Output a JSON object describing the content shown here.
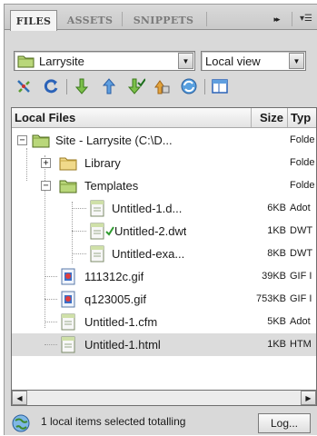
{
  "tabs": [
    {
      "label": "FILES",
      "active": true
    },
    {
      "label": "ASSETS",
      "active": false
    },
    {
      "label": "SNIPPETS",
      "active": false
    }
  ],
  "tab_overflow": "▸▸",
  "tab_menu": "▾☰",
  "site_select": {
    "value": "Larrysite"
  },
  "view_select": {
    "value": "Local view"
  },
  "toolbar": {
    "items": [
      "connect-icon",
      "refresh-icon",
      "get-files-icon",
      "put-files-icon",
      "check-out-icon",
      "check-in-icon",
      "sync-icon",
      "expand-icon"
    ]
  },
  "columns": {
    "name": "Local Files",
    "size": "Size",
    "type": "Typ"
  },
  "rows": [
    {
      "name": "Site - Larrysite (C:\\D...",
      "size": "",
      "type": "Folde"
    },
    {
      "name": "Library",
      "size": "",
      "type": "Folde"
    },
    {
      "name": "Templates",
      "size": "",
      "type": "Folde"
    },
    {
      "name": "Untitled-1.d...",
      "size": "6KB",
      "type": "Adot"
    },
    {
      "name": "Untitled-2.dwt",
      "size": "1KB",
      "type": "DWT"
    },
    {
      "name": "Untitled-exa...",
      "size": "8KB",
      "type": "DWT"
    },
    {
      "name": "111312c.gif",
      "size": "39KB",
      "type": "GIF I"
    },
    {
      "name": "q123005.gif",
      "size": "753KB",
      "type": "GIF I"
    },
    {
      "name": "Untitled-1.cfm",
      "size": "5KB",
      "type": "Adot"
    },
    {
      "name": "Untitled-1.html",
      "size": "1KB",
      "type": "HTM"
    }
  ],
  "status": {
    "text": "1 local items selected totalling",
    "log_button": "Log..."
  },
  "colors": {
    "panel": "#d9d9d9",
    "folder": "#b9d77a",
    "selected_row": "#dcdcdc",
    "check": "#2e9b2e"
  }
}
